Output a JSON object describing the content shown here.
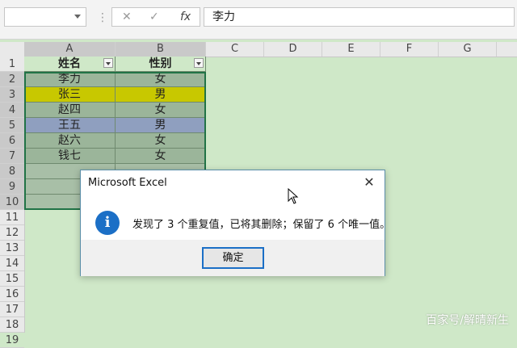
{
  "formula_bar": {
    "name_box_value": "",
    "separator_glyph": "⋮",
    "cancel_glyph": "✕",
    "enter_glyph": "✓",
    "fx_label": "fx",
    "formula_value": "李力"
  },
  "columns": [
    "A",
    "B",
    "C",
    "D",
    "E",
    "F",
    "G"
  ],
  "rows": [
    "1",
    "2",
    "3",
    "4",
    "5",
    "6",
    "7",
    "8",
    "9",
    "10",
    "11",
    "12",
    "13",
    "14",
    "15",
    "16",
    "17",
    "18",
    "19"
  ],
  "table": {
    "headers": [
      "姓名",
      "性别"
    ],
    "records": [
      {
        "name": "李力",
        "gender": "女",
        "color": "#9bb59a"
      },
      {
        "name": "张三",
        "gender": "男",
        "color": "#c8c800"
      },
      {
        "name": "赵四",
        "gender": "女",
        "color": "#9bb59a"
      },
      {
        "name": "王五",
        "gender": "男",
        "color": "#8f9fbf"
      },
      {
        "name": "赵六",
        "gender": "女",
        "color": "#9bb59a"
      },
      {
        "name": "钱七",
        "gender": "女",
        "color": "#9bb59a"
      }
    ]
  },
  "colors": {
    "sheet_bg": "#cfe8c8",
    "selection_border": "#217346",
    "empty_selected": "#a8bfa7"
  },
  "dialog": {
    "title": "Microsoft Excel",
    "close_glyph": "✕",
    "icon_glyph": "i",
    "message": "发现了 3 个重复值，已将其删除；保留了 6 个唯一值。",
    "ok_label": "确定"
  },
  "watermark": "百家号/解晴新生"
}
